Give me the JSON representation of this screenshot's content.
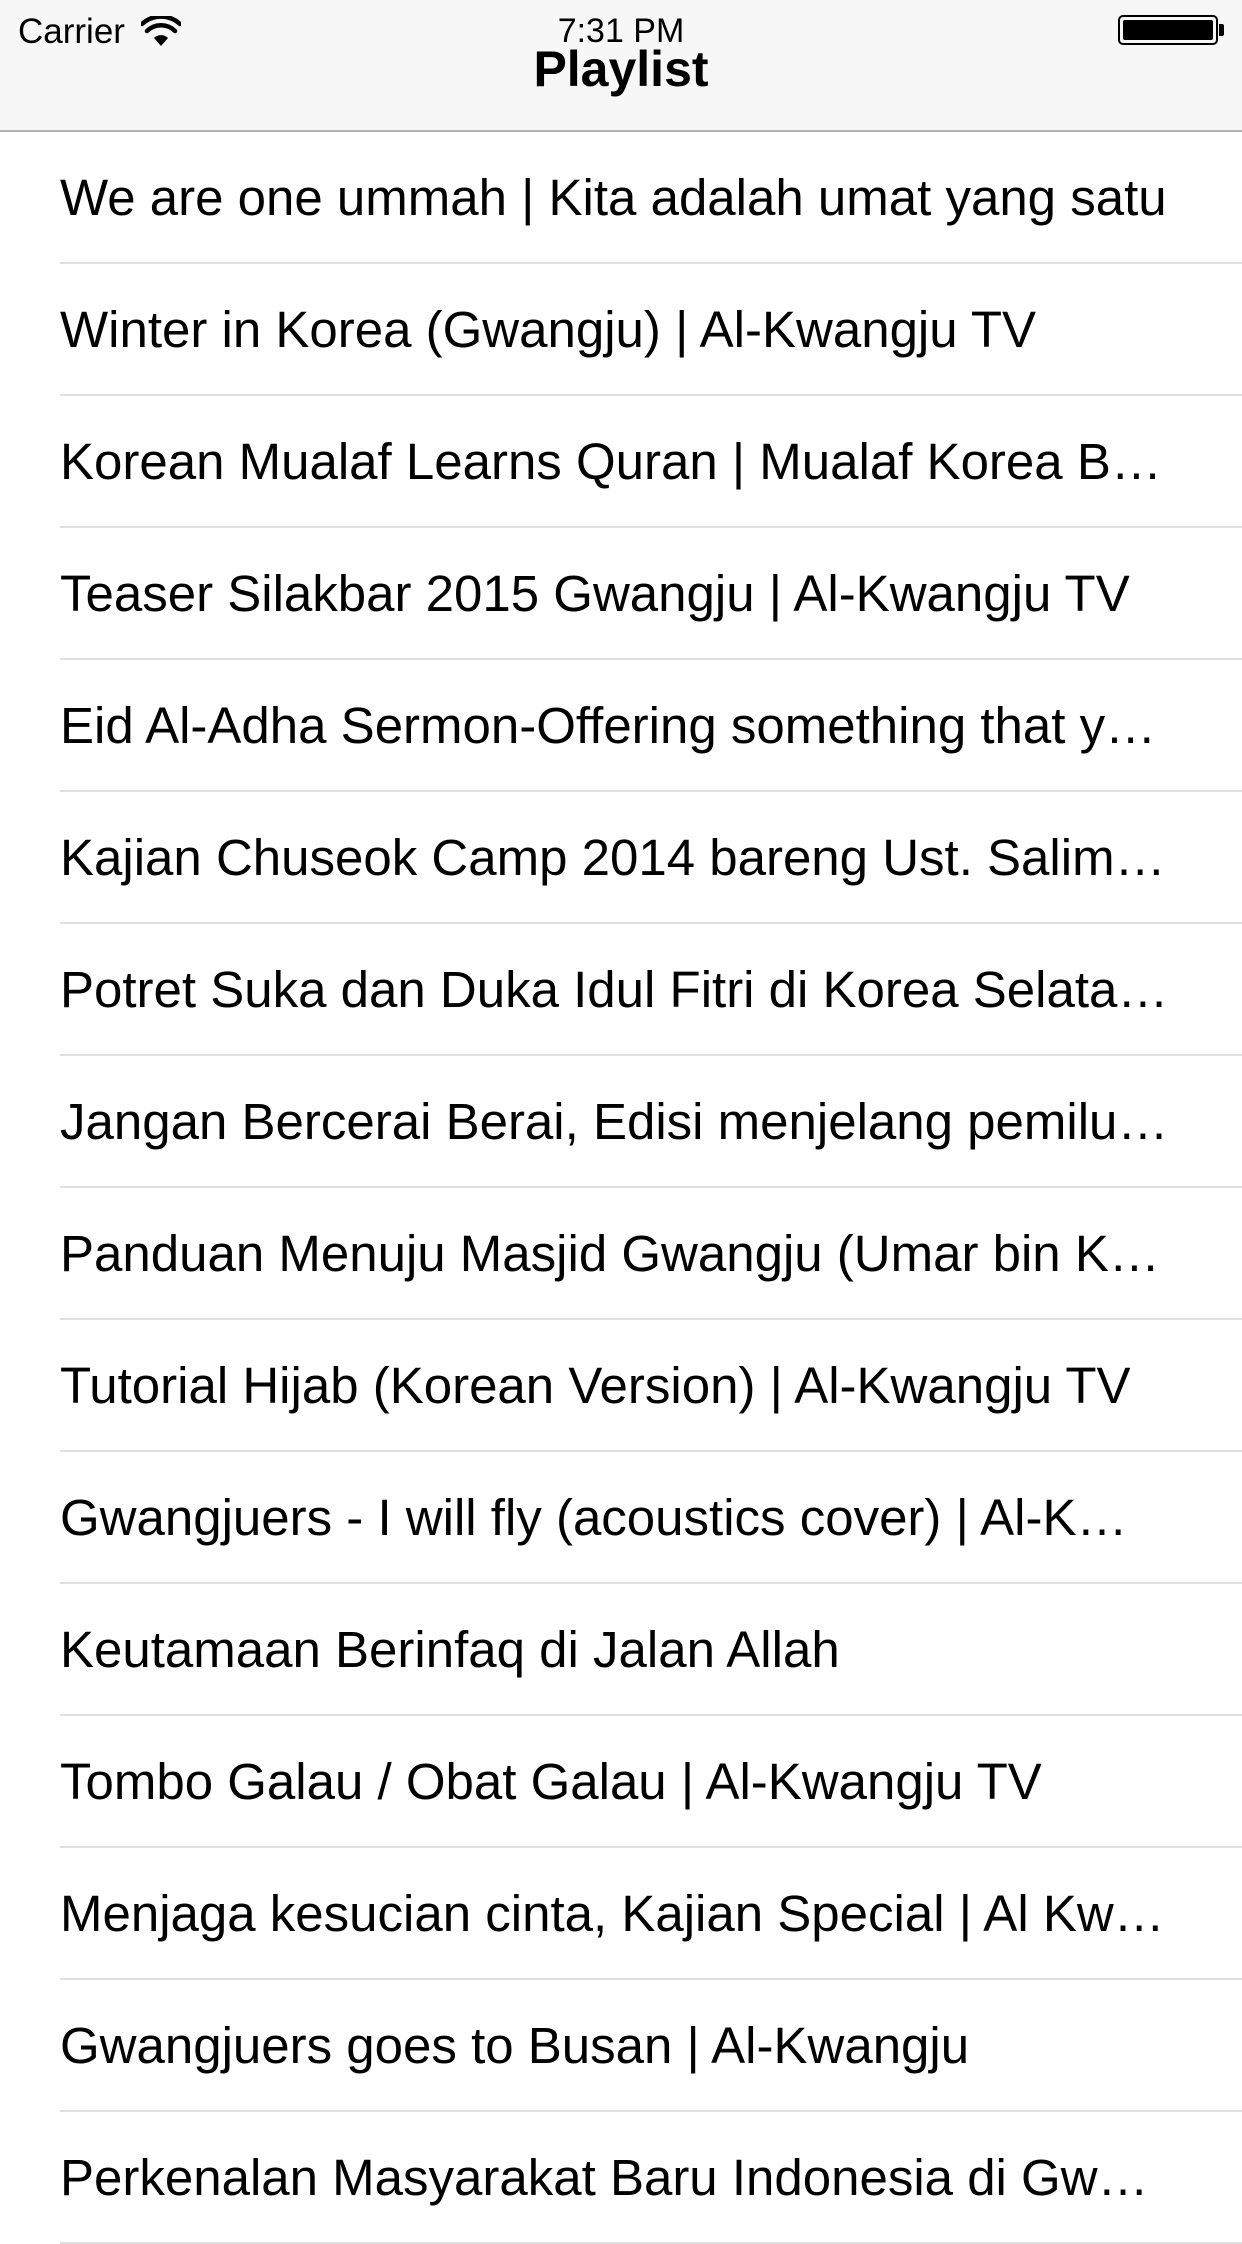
{
  "status_bar": {
    "carrier": "Carrier",
    "time": "7:31 PM",
    "wifi_icon": "wifi-icon",
    "battery_icon": "battery-icon"
  },
  "nav_bar": {
    "title": "Playlist"
  },
  "playlist": {
    "items": [
      {
        "label": "We are one ummah | Kita adalah umat yang satu"
      },
      {
        "label": "Winter in Korea (Gwangju) | Al-Kwangju TV"
      },
      {
        "label": "Korean Mualaf Learns Quran | Mualaf Korea B…"
      },
      {
        "label": "Teaser Silakbar 2015 Gwangju | Al-Kwangju TV"
      },
      {
        "label": "Eid Al-Adha Sermon-Offering something that y…"
      },
      {
        "label": "Kajian Chuseok Camp 2014 bareng Ust. Salim…"
      },
      {
        "label": "Potret Suka dan Duka Idul Fitri di Korea Selata…"
      },
      {
        "label": "Jangan Bercerai Berai, Edisi menjelang pemilu…"
      },
      {
        "label": "Panduan Menuju Masjid Gwangju (Umar bin K…"
      },
      {
        "label": "Tutorial Hijab (Korean Version) | Al-Kwangju TV"
      },
      {
        "label": "Gwangjuers - I will fly (acoustics cover) | Al-K…"
      },
      {
        "label": "Keutamaan Berinfaq di Jalan Allah"
      },
      {
        "label": "Tombo Galau / Obat Galau | Al-Kwangju TV"
      },
      {
        "label": "Menjaga kesucian cinta, Kajian Special | Al Kw…"
      },
      {
        "label": "Gwangjuers goes to Busan | Al-Kwangju"
      },
      {
        "label": "Perkenalan Masyarakat Baru Indonesia di Gw…"
      }
    ]
  }
}
